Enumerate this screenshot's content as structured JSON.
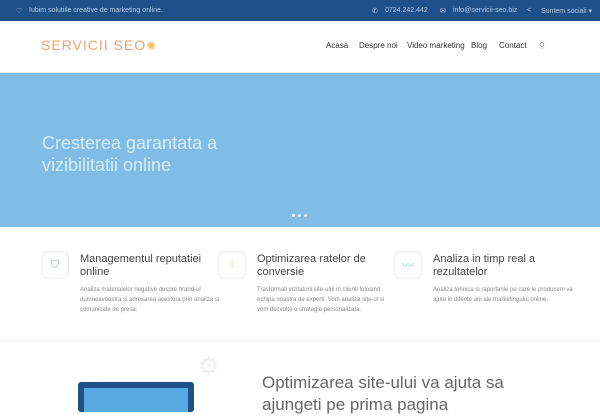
{
  "topbar": {
    "tagline": "Iubim solutiile creative de marketing online.",
    "phone": "0724.242.442",
    "email": "info@servicii-seo.biz",
    "social": "Suntem sociali"
  },
  "header": {
    "logo": "SERVICII SEO",
    "nav": [
      "Acasa",
      "Despre noi",
      "Video marketing",
      "Blog",
      "Contact"
    ]
  },
  "hero": {
    "title": "Cresterea garantata a vizibilitatii online",
    "slides": 3,
    "active_slide": 1
  },
  "features": [
    {
      "icon": "shield-icon",
      "title": "Managementul reputatiei online",
      "text": "Analiza materialelor negative despre brand-ul dumneavoastra si adresarea acestora prin analiza si comunicate de presa."
    },
    {
      "icon": "sliders-icon",
      "title": "Optimizarea ratelor de conversie",
      "text": "Trasformati vizitatorii site-ului in clienti folosind echipa noastra de experti. Vom analiza site-ul si vom dezvolta o strategie personalizata."
    },
    {
      "icon": "chart-line-icon",
      "title": "Analiza in timp real a rezultatelor",
      "text": "Analiza tehnica si raportarile pe care le producem va ajuta in diferite arii ale marketingului online."
    }
  ],
  "bottom": {
    "title": "Optimizarea site-ului va ajuta sa ajungeti pe prima pagina"
  }
}
